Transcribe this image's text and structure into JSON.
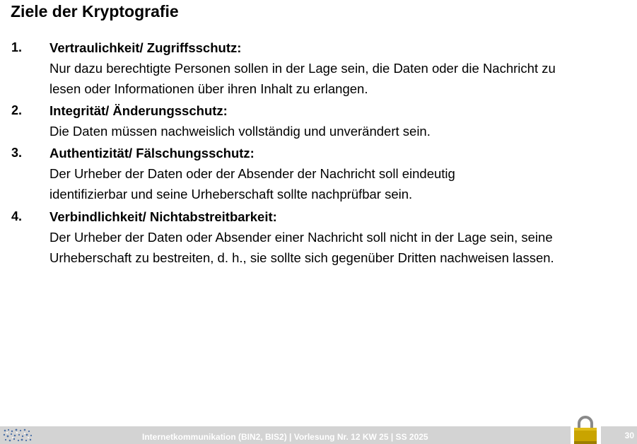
{
  "slide": {
    "title": "Ziele der Kryptografie"
  },
  "goals": [
    {
      "number": "1.",
      "heading": "Vertraulichkeit/ Zugriffsschutz:",
      "text": "Nur dazu berechtigte Personen sollen in der Lage sein, die Daten oder die Nachricht zu lesen oder Informationen über ihren Inhalt zu erlangen."
    },
    {
      "number": "2.",
      "heading": "Integrität/ Änderungsschutz:",
      "text": "Die Daten müssen nachweislich vollständig und unverändert sein."
    },
    {
      "number": "3.",
      "heading": "Authentizität/ Fälschungsschutz:",
      "text": "Der Urheber der Daten oder der Absender der Nachricht soll eindeutig identifizierbar und seine Urheberschaft sollte nachprüfbar sein."
    },
    {
      "number": "4.",
      "heading": "Verbindlichkeit/ Nichtabstreitbarkeit:",
      "text": "Der Urheber der Daten oder Absender einer Nachricht soll nicht in der Lage sein, seine Urheberschaft zu bestreiten, d. h., sie sollte sich gegenüber Dritten nachweisen lassen."
    }
  ],
  "footer": {
    "course_info": "Internetkommunikation (BIN2, BIS2) | Vorlesung Nr. 12 KW 25 | SS 2025",
    "page_number": "30",
    "logo_icon": "university-dots-logo-icon",
    "lock_icon": "padlock-icon",
    "bar_color": "#d3d3d3",
    "lock_color": "#c9a400"
  }
}
